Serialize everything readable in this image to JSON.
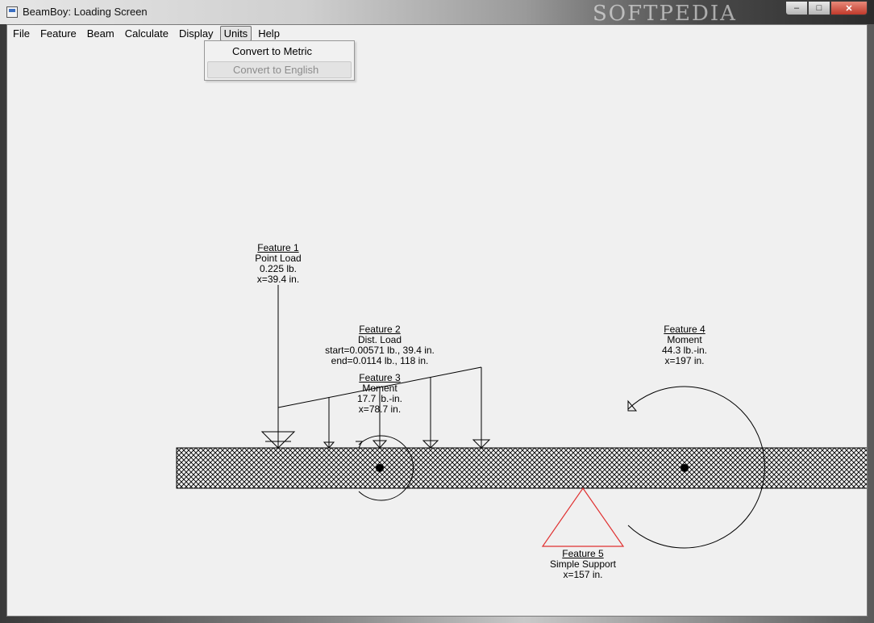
{
  "window": {
    "title": "BeamBoy: Loading Screen",
    "watermark": "SOFTPEDIA",
    "controls": {
      "minimize": "–",
      "maximize": "□",
      "close": "✕"
    }
  },
  "menubar": {
    "items": [
      "File",
      "Feature",
      "Beam",
      "Calculate",
      "Display",
      "Units",
      "Help"
    ],
    "open": "Units"
  },
  "units_menu": {
    "items": [
      "Convert to Metric",
      "Convert to English"
    ],
    "disabled": "Convert to English"
  },
  "features": [
    {
      "title": "Feature 1",
      "type": "Point Load",
      "line1": "0.225 lb.",
      "line2": "x=39.4 in.",
      "line3": ""
    },
    {
      "title": "Feature 2",
      "type": "Dist. Load",
      "line1": "start=0.00571 lb., 39.4 in.",
      "line2": "end=0.0114 lb., 118 in.",
      "line3": ""
    },
    {
      "title": "Feature 3",
      "type": "Moment",
      "line1": "17.7 lb.-in.",
      "line2": "x=78.7 in.",
      "line3": ""
    },
    {
      "title": "Feature 4",
      "type": "Moment",
      "line1": "44.3 lb.-in.",
      "line2": "x=197 in.",
      "line3": ""
    },
    {
      "title": "Feature 5",
      "type": "Simple Support",
      "line1": "x=157 in.",
      "line2": "",
      "line3": ""
    }
  ],
  "colors": {
    "support": "#e03030",
    "beam_hatch": "#000000",
    "menu_highlight": "#e2e2e2"
  }
}
